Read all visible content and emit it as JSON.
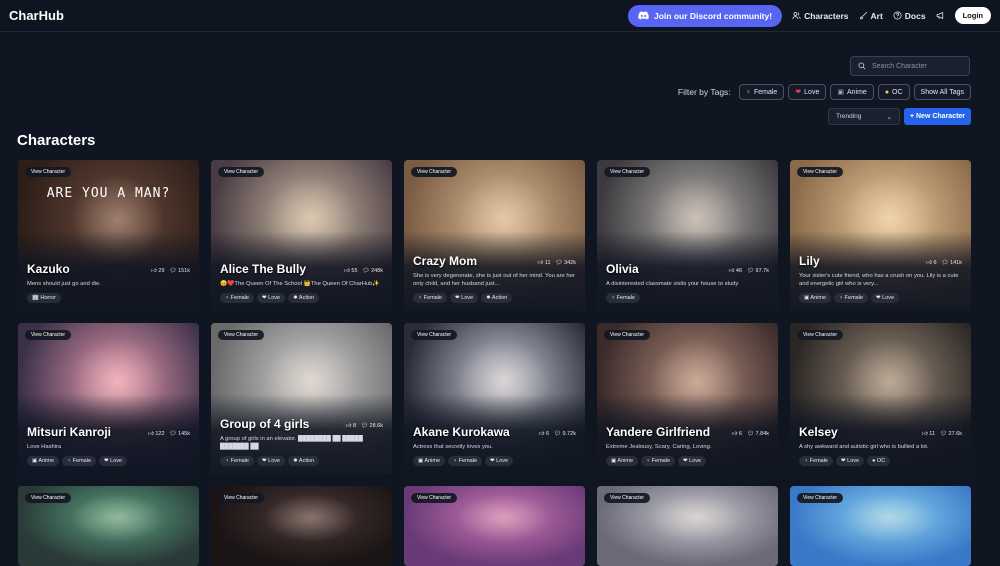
{
  "nav": {
    "logo": "CharHub",
    "discord": "Join our Discord community!",
    "characters": "Characters",
    "art": "Art",
    "docs": "Docs",
    "login": "Login"
  },
  "search": {
    "placeholder": "Search Character"
  },
  "filter": {
    "label": "Filter by Tags:",
    "tags": [
      {
        "icon": "♀",
        "label": "Female"
      },
      {
        "icon": "❤",
        "label": "Love"
      },
      {
        "icon": "▣",
        "label": "Anime"
      },
      {
        "icon": "●",
        "label": "OC"
      },
      {
        "icon": "",
        "label": "Show All Tags"
      }
    ]
  },
  "sort": {
    "value": "Trending"
  },
  "new_character": "+ New Character",
  "section_title": "Characters",
  "view_label": "View Character",
  "cards": [
    {
      "name": "Kazuko",
      "likes": "29",
      "chats": "151k",
      "desc": "Mens should just go and die.",
      "tags": [
        "🏢 Horror"
      ],
      "colors": [
        "#6b4a3c",
        "#2d1e18"
      ],
      "overlay_text": "ARE YOU A MAN?"
    },
    {
      "name": "Alice The Bully",
      "likes": "55",
      "chats": "248k",
      "desc": "😠❤️The Queen Of The School 👑The Queen Of CharHub✨",
      "tags": [
        "♀ Female",
        "❤ Love",
        "✹ Action"
      ],
      "colors": [
        "#c8b8a0",
        "#4a3c44"
      ]
    },
    {
      "name": "Crazy Mom",
      "likes": "11",
      "chats": "342k",
      "desc": "She is very degenerate, she is just out of her mind. You are her only child, and her husband just...",
      "tags": [
        "♀ Female",
        "❤ Love",
        "✹ Action"
      ],
      "colors": [
        "#d8b890",
        "#7a5c44"
      ]
    },
    {
      "name": "Olivia",
      "likes": "46",
      "chats": "97.7k",
      "desc": "A disinterested classmate visits your house to study",
      "tags": [
        "♀ Female"
      ],
      "colors": [
        "#b0aca8",
        "#3c3a3e"
      ]
    },
    {
      "name": "Lily",
      "likes": "6",
      "chats": "141k",
      "desc": "Your sister's cute friend, who has a crush on you. Lily is a cute and energetic girl who is very...",
      "tags": [
        "▣ Anime",
        "♀ Female",
        "❤ Love"
      ],
      "colors": [
        "#e8c898",
        "#8a6a4a"
      ]
    },
    {
      "name": "Mitsuri Kanroji",
      "likes": "122",
      "chats": "145k",
      "desc": "Love Hashira",
      "tags": [
        "▣ Anime",
        "♀ Female",
        "❤ Love"
      ],
      "colors": [
        "#e89ab0",
        "#3a3048"
      ]
    },
    {
      "name": "Group of 4 girls",
      "likes": "8",
      "chats": "28.6k",
      "desc": "A group of girls in an elevator. ████████ ██ █████ ███████ ██",
      "tags": [
        "♀ Female",
        "❤ Love",
        "✹ Action"
      ],
      "colors": [
        "#d0d0d0",
        "#6a6a6a"
      ]
    },
    {
      "name": "Akane Kurokawa",
      "likes": "6",
      "chats": "9.72k",
      "desc": "Actress that secretly loves you.",
      "tags": [
        "▣ Anime",
        "♀ Female",
        "❤ Love"
      ],
      "colors": [
        "#c8ccd8",
        "#2a2c3a"
      ]
    },
    {
      "name": "Yandere Girlfriend",
      "likes": "6",
      "chats": "7.84k",
      "desc": "Extreme Jealousy, Scary, Caring, Loving.",
      "tags": [
        "▣ Anime",
        "♀ Female",
        "❤ Love"
      ],
      "colors": [
        "#b08a7a",
        "#3a2a2a"
      ]
    },
    {
      "name": "Kelsey",
      "likes": "11",
      "chats": "27.6k",
      "desc": "A shy awkward and autistic girl who is bullied a lot.",
      "tags": [
        "♀ Female",
        "❤ Love",
        "● OC"
      ],
      "colors": [
        "#9a8a78",
        "#2a2624"
      ]
    },
    {
      "colors": [
        "#5aa080",
        "#2a3a38"
      ]
    },
    {
      "colors": [
        "#4a3838",
        "#1a1414"
      ]
    },
    {
      "colors": [
        "#c878b0",
        "#6a3a78"
      ]
    },
    {
      "colors": [
        "#c8c8d0",
        "#6a6a78"
      ]
    },
    {
      "colors": [
        "#88d0f0",
        "#3a78c8"
      ]
    }
  ]
}
